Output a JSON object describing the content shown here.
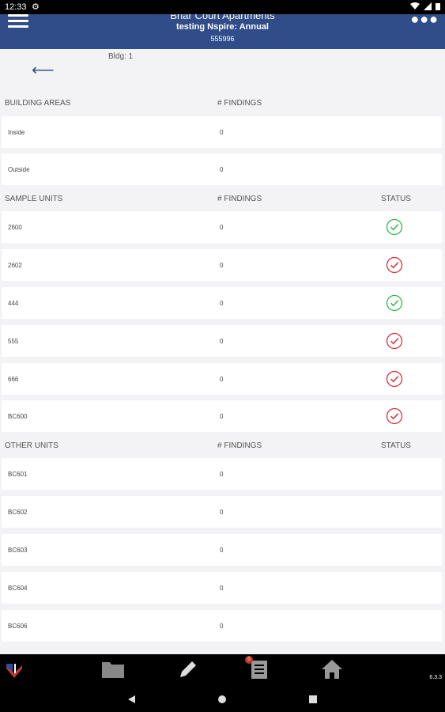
{
  "status_bar": {
    "time": "12:33"
  },
  "header": {
    "title": "Briar Court Apartments",
    "subtitle": "testing Nspire: Annual",
    "code": "555996"
  },
  "building": {
    "label": "Bldg: 1"
  },
  "sections": {
    "building_areas": {
      "col1": "BUILDING AREAS",
      "col2": "# FINDINGS"
    },
    "sample_units": {
      "col1": "SAMPLE UNITS",
      "col2": "# FINDINGS",
      "col3": "STATUS"
    },
    "other_units": {
      "col1": "OTHER UNITS",
      "col2": "# FINDINGS",
      "col3": "STATUS"
    }
  },
  "building_areas": [
    {
      "name": "Inside",
      "findings": "0"
    },
    {
      "name": "Outside",
      "findings": "0"
    }
  ],
  "sample_units": [
    {
      "name": "2600",
      "findings": "0",
      "status": "complete"
    },
    {
      "name": "2602",
      "findings": "0",
      "status": "incomplete"
    },
    {
      "name": "444",
      "findings": "0",
      "status": "complete"
    },
    {
      "name": "555",
      "findings": "0",
      "status": "incomplete"
    },
    {
      "name": "666",
      "findings": "0",
      "status": "incomplete"
    },
    {
      "name": "BC600",
      "findings": "0",
      "status": "incomplete"
    }
  ],
  "other_units": [
    {
      "name": "BC601",
      "findings": "0"
    },
    {
      "name": "BC602",
      "findings": "0"
    },
    {
      "name": "BC603",
      "findings": "0"
    },
    {
      "name": "BC604",
      "findings": "0"
    },
    {
      "name": "BC606",
      "findings": "0"
    }
  ],
  "bottom_nav": {
    "badge": "0",
    "version": "6.3.3"
  },
  "colors": {
    "header_bg": "#304d89",
    "status_complete": "#2fb84a",
    "status_incomplete": "#d6323a"
  },
  "icons": {
    "menu": "hamburger-icon",
    "more": "dots-icon",
    "back": "arrow-left-icon",
    "status_complete": "check-circle-icon",
    "status_incomplete": "check-circle-icon",
    "nav": [
      "logo-icon",
      "folder-icon",
      "pencil-icon",
      "clipboard-list-icon",
      "home-icon"
    ],
    "system": [
      "back-triangle-icon",
      "home-circle-icon",
      "recents-square-icon"
    ]
  }
}
